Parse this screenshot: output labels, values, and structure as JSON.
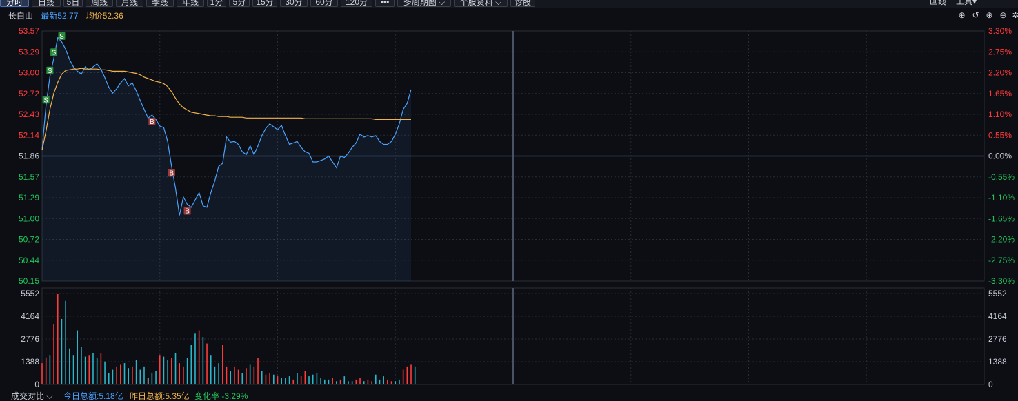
{
  "toolbar": {
    "buttons": [
      {
        "label": "分时",
        "active": true
      },
      {
        "label": "日线",
        "active": false
      },
      {
        "label": "5日",
        "active": false
      },
      {
        "label": "周线",
        "active": false
      },
      {
        "label": "月线",
        "active": false
      },
      {
        "label": "季线",
        "active": false
      },
      {
        "label": "年线",
        "active": false
      },
      {
        "label": "1分",
        "active": false
      },
      {
        "label": "5分",
        "active": false
      },
      {
        "label": "15分",
        "active": false
      },
      {
        "label": "30分",
        "active": false
      },
      {
        "label": "60分",
        "active": false
      },
      {
        "label": "120分",
        "active": false
      },
      {
        "label": "•••",
        "active": false
      },
      {
        "label": "多周期图 ⌵",
        "active": false
      },
      {
        "label": "个股资料 ⌵",
        "active": false
      },
      {
        "label": "诊股",
        "active": false
      }
    ],
    "right_items": [
      "画线",
      "工具▾"
    ]
  },
  "info": {
    "stock_name": "长白山",
    "latest": "最新52.77",
    "avg": "均价52.36"
  },
  "colors": {
    "up": "#ff3b3b",
    "down": "#21c45a",
    "price_line": "#4aa3ff",
    "avg_line": "#f0b24a",
    "grid": "#2a2d38",
    "buy_marker": "#9b3b3b",
    "sell_marker": "#2b8a3e"
  },
  "price_axis": {
    "left_labels": [
      "53.57",
      "53.29",
      "53.00",
      "52.72",
      "52.43",
      "52.14",
      "51.86",
      "51.57",
      "51.29",
      "51.00",
      "50.72",
      "50.44",
      "50.15"
    ],
    "right_labels": [
      "3.30%",
      "2.75%",
      "2.20%",
      "1.65%",
      "1.10%",
      "0.55%",
      "0.00%",
      "-0.55%",
      "-1.10%",
      "-1.65%",
      "-2.20%",
      "-2.75%",
      "-3.30%"
    ],
    "ylim": [
      50.15,
      53.57
    ],
    "prev_close": 51.86
  },
  "volume_axis": {
    "labels": [
      "5552",
      "4164",
      "2776",
      "1388",
      "0"
    ],
    "ylim": [
      0,
      5552
    ]
  },
  "chart_data": {
    "type": "line",
    "series": [
      {
        "values": [
          51.94,
          52.55,
          52.95,
          53.2,
          53.48,
          53.42,
          53.32,
          53.18,
          53.08,
          53.02,
          52.98,
          53.08,
          53.04,
          53.08,
          53.12,
          53.05,
          52.93,
          52.8,
          52.72,
          52.78,
          52.86,
          52.92,
          52.82,
          52.86,
          52.75,
          52.62,
          52.5,
          52.38,
          52.42,
          52.36,
          52.27,
          52.25,
          52.06,
          51.72,
          51.42,
          51.05,
          51.3,
          51.2,
          51.16,
          51.26,
          51.36,
          51.18,
          51.16,
          51.36,
          51.52,
          51.72,
          51.76,
          52.12,
          52.05,
          52.06,
          52.02,
          51.92,
          51.88,
          52.0,
          51.88,
          52.0,
          52.14,
          52.24,
          52.3,
          52.26,
          52.22,
          52.28,
          52.14,
          52.02,
          52.04,
          52.06,
          51.98,
          51.92,
          51.9,
          51.78,
          51.78,
          51.8,
          51.82,
          51.86,
          51.78,
          51.7,
          51.86,
          51.84,
          51.9,
          51.98,
          52.04,
          52.16,
          52.12,
          52.14,
          52.12,
          52.14,
          52.06,
          52.02,
          52.02,
          52.06,
          52.16,
          52.3,
          52.5,
          52.58,
          52.77
        ]
      },
      {
        "values": [
          51.94,
          52.2,
          52.5,
          52.72,
          52.87,
          52.98,
          53.03,
          53.04,
          53.05,
          53.05,
          53.06,
          53.05,
          53.05,
          53.05,
          53.05,
          53.04,
          53.04,
          53.03,
          53.02,
          53.02,
          53.02,
          53.02,
          53.01,
          53.0,
          52.99,
          52.97,
          52.94,
          52.92,
          52.9,
          52.88,
          52.87,
          52.85,
          52.81,
          52.74,
          52.65,
          52.57,
          52.52,
          52.49,
          52.46,
          52.45,
          52.44,
          52.43,
          52.42,
          52.41,
          52.41,
          52.4,
          52.4,
          52.4,
          52.39,
          52.39,
          52.39,
          52.39,
          52.38,
          52.38,
          52.38,
          52.38,
          52.38,
          52.38,
          52.38,
          52.38,
          52.38,
          52.38,
          52.38,
          52.38,
          52.38,
          52.38,
          52.38,
          52.37,
          52.37,
          52.37,
          52.37,
          52.37,
          52.37,
          52.37,
          52.37,
          52.37,
          52.37,
          52.37,
          52.37,
          52.37,
          52.37,
          52.37,
          52.37,
          52.37,
          52.37,
          52.36,
          52.36,
          52.36,
          52.36,
          52.36,
          52.36,
          52.36,
          52.36,
          52.36,
          52.36
        ]
      }
    ],
    "markers": [
      {
        "type": "S",
        "index": 1
      },
      {
        "type": "S",
        "index": 2
      },
      {
        "type": "S",
        "index": 3
      },
      {
        "type": "S",
        "index": 5
      },
      {
        "type": "B",
        "index": 28
      },
      {
        "type": "B",
        "index": 33
      },
      {
        "type": "B",
        "index": 37
      }
    ],
    "volumes": [
      1300,
      1650,
      1800,
      3700,
      5552,
      4000,
      5100,
      2200,
      1800,
      3300,
      2300,
      1700,
      1800,
      1900,
      1600,
      1900,
      1400,
      700,
      900,
      1100,
      1200,
      1300,
      1000,
      1100,
      1500,
      900,
      1100,
      400,
      700,
      800,
      1800,
      1700,
      1500,
      1600,
      1900,
      1300,
      1100,
      1600,
      2400,
      3100,
      3300,
      2900,
      2500,
      1800,
      1100,
      1300,
      2400,
      1100,
      800,
      1100,
      900,
      700,
      1000,
      1200,
      1100,
      1600,
      800,
      600,
      700,
      600,
      500,
      400,
      400,
      500,
      300,
      700,
      500,
      800,
      500,
      600,
      700,
      400,
      300,
      300,
      400,
      200,
      300,
      500,
      200,
      200,
      300,
      400,
      200,
      300,
      200,
      600,
      300,
      500,
      300,
      200,
      200,
      300,
      900,
      1100,
      1200,
      1100
    ],
    "volume_colors": [
      "r",
      "r",
      "c",
      "r",
      "r",
      "c",
      "c",
      "c",
      "c",
      "c",
      "c",
      "c",
      "r",
      "c",
      "c",
      "r",
      "c",
      "c",
      "c",
      "r",
      "r",
      "c",
      "c",
      "r",
      "c",
      "c",
      "c",
      "w",
      "c",
      "c",
      "r",
      "c",
      "c",
      "r",
      "c",
      "r",
      "r",
      "c",
      "c",
      "c",
      "r",
      "c",
      "r",
      "c",
      "c",
      "c",
      "r",
      "r",
      "c",
      "r",
      "r",
      "c",
      "r",
      "c",
      "r",
      "r",
      "c",
      "r",
      "r",
      "c",
      "r",
      "c",
      "c",
      "c",
      "r",
      "c",
      "r",
      "r",
      "c",
      "c",
      "c",
      "c",
      "c",
      "c",
      "r",
      "c",
      "r",
      "c",
      "c",
      "c",
      "r",
      "r",
      "c",
      "r",
      "r",
      "c",
      "c",
      "c",
      "r",
      "r",
      "c",
      "c",
      "r",
      "r",
      "r"
    ]
  },
  "bottom": {
    "compare_label": "成交对比 ⌵",
    "today_total": "今日总额:5.18亿",
    "yesterday_total": "昨日总额:5.35亿",
    "change_rate": "变化率 -3.29%"
  }
}
